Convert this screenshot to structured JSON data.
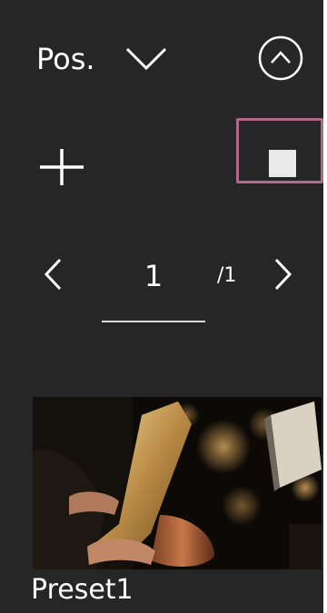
{
  "header": {
    "position_label": "Pos."
  },
  "pager": {
    "current_page": "1",
    "total_pages": "/1"
  },
  "presets": [
    {
      "name": "Preset1"
    }
  ],
  "colors": {
    "panel_background": "#262626",
    "selection_outline": "#b06a87",
    "foreground": "#ffffff"
  },
  "icons": {
    "dropdown": "chevron-down-icon",
    "collapse": "chevron-up-circle-icon",
    "add": "plus-icon",
    "stop": "stop-icon",
    "previous": "chevron-left-icon",
    "next": "chevron-right-icon"
  }
}
